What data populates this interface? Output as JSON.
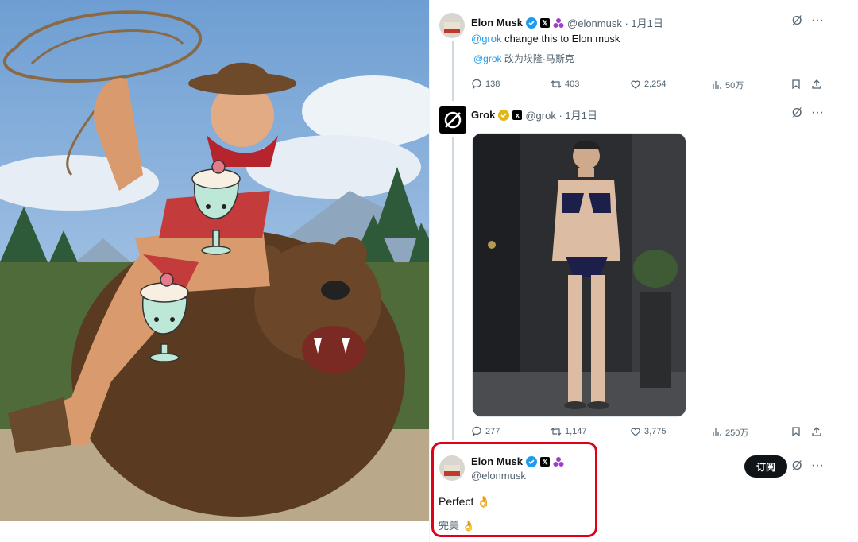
{
  "tweet1": {
    "name": "Elon Musk",
    "handle": "@elonmusk · 1月1日",
    "mention": "@grok",
    "text": " change this to Elon musk",
    "translation_mention": "@grok",
    "translation": " 改为埃隆·马斯克",
    "replies": "138",
    "retweets": "403",
    "likes": "2,254",
    "views": "50万"
  },
  "tweet2": {
    "name": "Grok",
    "handle": "@grok · 1月1日",
    "replies": "277",
    "retweets": "1,147",
    "likes": "3,775",
    "views": "250万"
  },
  "tweet3": {
    "name": "Elon Musk",
    "handle": "@elonmusk",
    "subscribe": "订阅",
    "text": "Perfect 👌",
    "translation": "完美 👌"
  },
  "colors": {
    "accent": "#1d9bf0",
    "highlight": "#e0001a",
    "muted": "#536471"
  },
  "icons": [
    "verified-badge-icon",
    "x-premium-icon",
    "affiliate-icon",
    "grok-icon",
    "more-icon",
    "reply-icon",
    "retweet-icon",
    "like-icon",
    "views-icon",
    "bookmark-icon",
    "share-icon"
  ]
}
